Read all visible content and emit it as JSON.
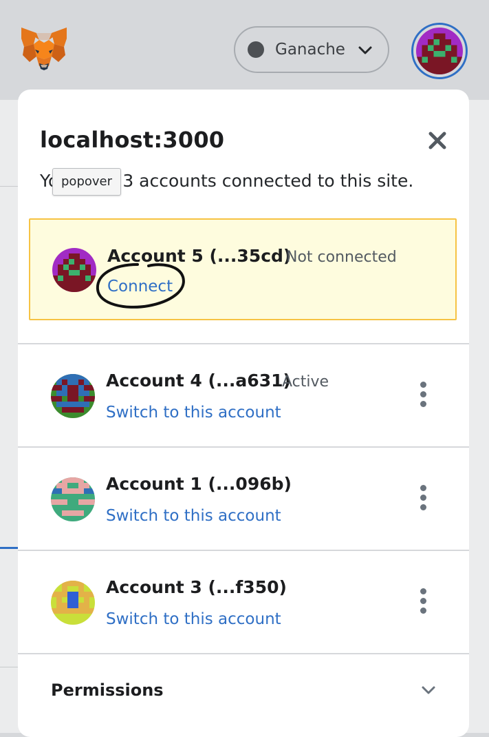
{
  "header": {
    "network_name": "Ganache",
    "logo_icon": "metamask-fox-icon"
  },
  "popover": {
    "title": "localhost:3000",
    "subtitle_prefix": "Yo",
    "subtitle_text": "u have 3 accounts connected to this site.",
    "tooltip": "popover"
  },
  "accounts": [
    {
      "name": "Account 5 (...35cd)",
      "status": "Not connected",
      "action": "Connect"
    },
    {
      "name": "Account 4 (...a631)",
      "status": "Active",
      "action": "Switch to this account"
    },
    {
      "name": "Account 1 (...096b)",
      "status": "",
      "action": "Switch to this account"
    },
    {
      "name": "Account 3 (...f350)",
      "status": "",
      "action": "Switch to this account"
    }
  ],
  "permissions": {
    "label": "Permissions"
  },
  "colors": {
    "accent": "#2f6fc5",
    "warning_bg": "#fefcde",
    "warning_border": "#f6c343"
  }
}
